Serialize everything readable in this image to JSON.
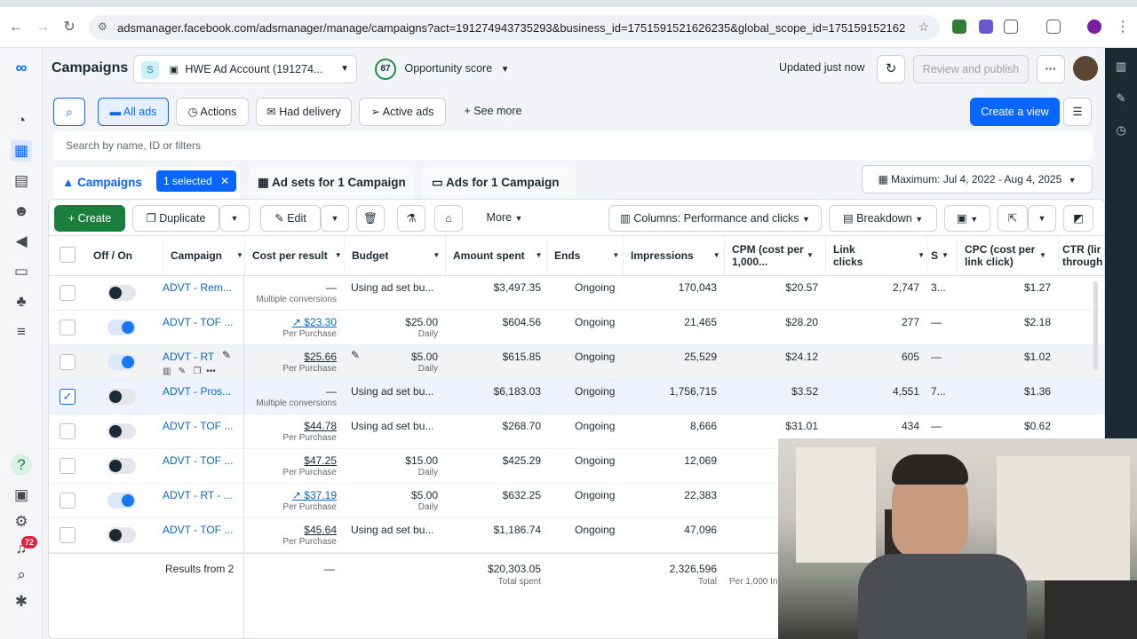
{
  "browser": {
    "url": "adsmanager.facebook.com/adsmanager/manage/campaigns?act=191274943735293&business_id=1751591521626235&global_scope_id=175159152162623..."
  },
  "header": {
    "title": "Campaigns",
    "account_badge": "S",
    "account_name": "HWE Ad Account (191274...",
    "opportunity_score": "87",
    "opportunity_label": "Opportunity score",
    "updated": "Updated just now",
    "review_publish": "Review and publish",
    "more": "···"
  },
  "filters": {
    "all_ads": "All ads",
    "actions": "Actions",
    "had_delivery": "Had delivery",
    "active_ads": "Active ads",
    "see_more": "See more",
    "create_view": "Create a view",
    "search_placeholder": "Search by name, ID or filters"
  },
  "tabs": {
    "campaigns": "Campaigns",
    "selected": "1 selected",
    "ad_sets": "Ad sets for 1 Campaign",
    "ads": "Ads for 1 Campaign",
    "date_range": "Maximum: Jul 4, 2022 - Aug 4, 2025"
  },
  "toolbar": {
    "create": "Create",
    "duplicate": "Duplicate",
    "edit": "Edit",
    "more": "More",
    "columns": "Columns: Performance and clicks",
    "breakdown": "Breakdown"
  },
  "columns": {
    "off_on": "Off / On",
    "campaign": "Campaign",
    "cost_per_result": "Cost per result",
    "budget": "Budget",
    "amount_spent": "Amount spent",
    "ends": "Ends",
    "impressions": "Impressions",
    "cpm": "CPM (cost per 1,000...",
    "link_clicks": "Link clicks",
    "s": "S",
    "cpc": "CPC (cost per link click)",
    "ctr": "CTR (lir through"
  },
  "rows": [
    {
      "name": "ADVT - Rem...",
      "cpr": "—",
      "cpr_sub": "Multiple conversions",
      "budget": "Using ad set bu...",
      "budget_sub": "",
      "spent": "$3,497.35",
      "ends": "Ongoing",
      "impressions": "170,043",
      "cpm": "$20.57",
      "clicks": "2,747",
      "s": "3...",
      "cpc": "$1.27",
      "on": false,
      "checked": false
    },
    {
      "name": "ADVT - TOF ...",
      "cpr": "↗ $23.30",
      "cpr_sub": "Per Purchase",
      "budget": "$25.00",
      "budget_sub": "Daily",
      "spent": "$604.56",
      "ends": "Ongoing",
      "impressions": "21,465",
      "cpm": "$28.20",
      "clicks": "277",
      "s": "—",
      "cpc": "$2.18",
      "on": true,
      "checked": false
    },
    {
      "name": "ADVT - RT",
      "cpr": "$25.66",
      "cpr_sub": "Per Purchase",
      "budget": "$5.00",
      "budget_sub": "Daily",
      "spent": "$615.85",
      "ends": "Ongoing",
      "impressions": "25,529",
      "cpm": "$24.12",
      "clicks": "605",
      "s": "—",
      "cpc": "$1.02",
      "on": true,
      "checked": false
    },
    {
      "name": "ADVT - Pros...",
      "cpr": "—",
      "cpr_sub": "Multiple conversions",
      "budget": "Using ad set bu...",
      "budget_sub": "",
      "spent": "$6,183.03",
      "ends": "Ongoing",
      "impressions": "1,756,715",
      "cpm": "$3.52",
      "clicks": "4,551",
      "s": "7...",
      "cpc": "$1.36",
      "on": false,
      "checked": true
    },
    {
      "name": "ADVT - TOF ...",
      "cpr": "$44.78",
      "cpr_sub": "Per Purchase",
      "budget": "Using ad set bu...",
      "budget_sub": "",
      "spent": "$268.70",
      "ends": "Ongoing",
      "impressions": "8,666",
      "cpm": "$31.01",
      "clicks": "434",
      "s": "—",
      "cpc": "$0.62",
      "on": false,
      "checked": false
    },
    {
      "name": "ADVT - TOF ...",
      "cpr": "$47.25",
      "cpr_sub": "Per Purchase",
      "budget": "$15.00",
      "budget_sub": "Daily",
      "spent": "$425.29",
      "ends": "Ongoing",
      "impressions": "12,069",
      "cpm": "",
      "clicks": "",
      "s": "",
      "cpc": "",
      "on": false,
      "checked": false
    },
    {
      "name": "ADVT - RT - ...",
      "cpr": "↗ $37.19",
      "cpr_sub": "Per Purchase",
      "budget": "$5.00",
      "budget_sub": "Daily",
      "spent": "$632.25",
      "ends": "Ongoing",
      "impressions": "22,383",
      "cpm": "",
      "clicks": "",
      "s": "",
      "cpc": "",
      "on": true,
      "checked": false
    },
    {
      "name": "ADVT - TOF ...",
      "cpr": "$45.64",
      "cpr_sub": "Per Purchase",
      "budget": "Using ad set bu...",
      "budget_sub": "",
      "spent": "$1,186.74",
      "ends": "Ongoing",
      "impressions": "47,096",
      "cpm": "",
      "clicks": "",
      "s": "",
      "cpc": "",
      "on": false,
      "checked": false
    }
  ],
  "totals": {
    "label": "Results from 2",
    "cpr": "—",
    "spent": "$20,303.05",
    "spent_sub": "Total spent",
    "impressions": "2,326,596",
    "impressions_sub": "Total",
    "cpm_sub": "Per 1,000 In"
  },
  "leftnav": {
    "notifications": "72"
  }
}
